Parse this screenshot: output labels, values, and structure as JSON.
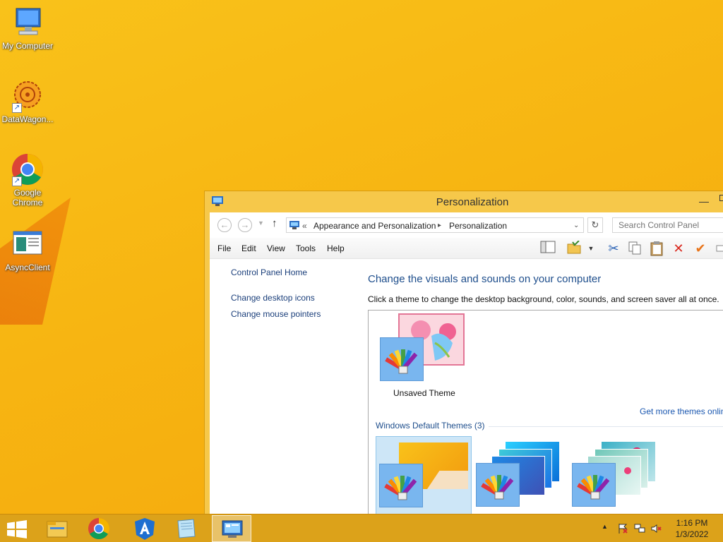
{
  "desktop": {
    "icons": [
      {
        "label": "My Computer",
        "icon": "computer-icon"
      },
      {
        "label": "DataWagon...",
        "icon": "datawagon-icon"
      },
      {
        "label": "Google Chrome",
        "icon": "chrome-icon"
      },
      {
        "label": "AsyncClient",
        "icon": "asyncclient-icon"
      }
    ]
  },
  "window": {
    "title": "Personalization",
    "address": {
      "chevron": "«",
      "crumb1": "Appearance and Personalization",
      "sep": "▸",
      "crumb2": "Personalization"
    },
    "search_placeholder": "Search Control Panel",
    "menu": [
      "File",
      "Edit",
      "View",
      "Tools",
      "Help"
    ],
    "left_nav": {
      "home": "Control Panel Home",
      "desktop_icons": "Change desktop icons",
      "mouse_pointers": "Change mouse pointers"
    },
    "heading": "Change the visuals and sounds on your computer",
    "subtext": "Click a theme to change the desktop background, color, sounds, and screen saver all at once.",
    "unsaved_theme": "Unsaved Theme",
    "get_more": "Get more themes online",
    "default_group": "Windows Default Themes (3)"
  },
  "taskbar": {
    "time": "1:16 PM",
    "date": "1/3/2022",
    "buttons": [
      "file-explorer-icon",
      "chrome-icon",
      "angular-icon",
      "notepad-icon",
      "control-panel-icon"
    ]
  },
  "colors": {
    "accent": "#f7b512",
    "link": "#1a3e7a",
    "heading": "#1e4e8c"
  }
}
